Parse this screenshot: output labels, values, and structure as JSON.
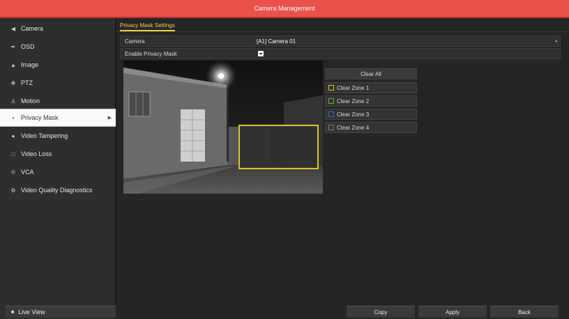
{
  "window": {
    "title": "Camera Management"
  },
  "sidebar": {
    "items": [
      {
        "label": "Camera",
        "icon": "camera-icon"
      },
      {
        "label": "OSD",
        "icon": "pencil-icon"
      },
      {
        "label": "Image",
        "icon": "image-icon"
      },
      {
        "label": "PTZ",
        "icon": "ptz-icon"
      },
      {
        "label": "Motion",
        "icon": "motion-icon"
      },
      {
        "label": "Privacy Mask",
        "icon": "privacy-mask-icon",
        "active": true
      },
      {
        "label": "Video Tampering",
        "icon": "tampering-icon"
      },
      {
        "label": "Video Loss",
        "icon": "video-loss-icon"
      },
      {
        "label": "VCA",
        "icon": "vca-icon"
      },
      {
        "label": "Video Quality Diagnostics",
        "icon": "diagnostics-icon"
      }
    ],
    "live_view": "Live View"
  },
  "main": {
    "tab": "Privacy Mask Settings",
    "camera_label": "Camera",
    "camera_value": "[A1] Camera 01",
    "enable_label": "Enable Privacy Mask",
    "enable_checked": true,
    "zones": {
      "clear_all": "Clear All",
      "items": [
        {
          "label": "Clear Zone 1",
          "color": "#d9c62c"
        },
        {
          "label": "Clear Zone 2",
          "color": "#62b32f"
        },
        {
          "label": "Clear Zone 3",
          "color": "#3e63c9"
        },
        {
          "label": "Clear Zone 4",
          "color": "#7a7a7a"
        }
      ]
    },
    "buttons": {
      "copy": "Copy",
      "apply": "Apply",
      "back": "Back"
    }
  },
  "colors": {
    "titlebar": "#e9524a",
    "accent": "#f0d24a",
    "mask_border": "#d9c62c"
  }
}
